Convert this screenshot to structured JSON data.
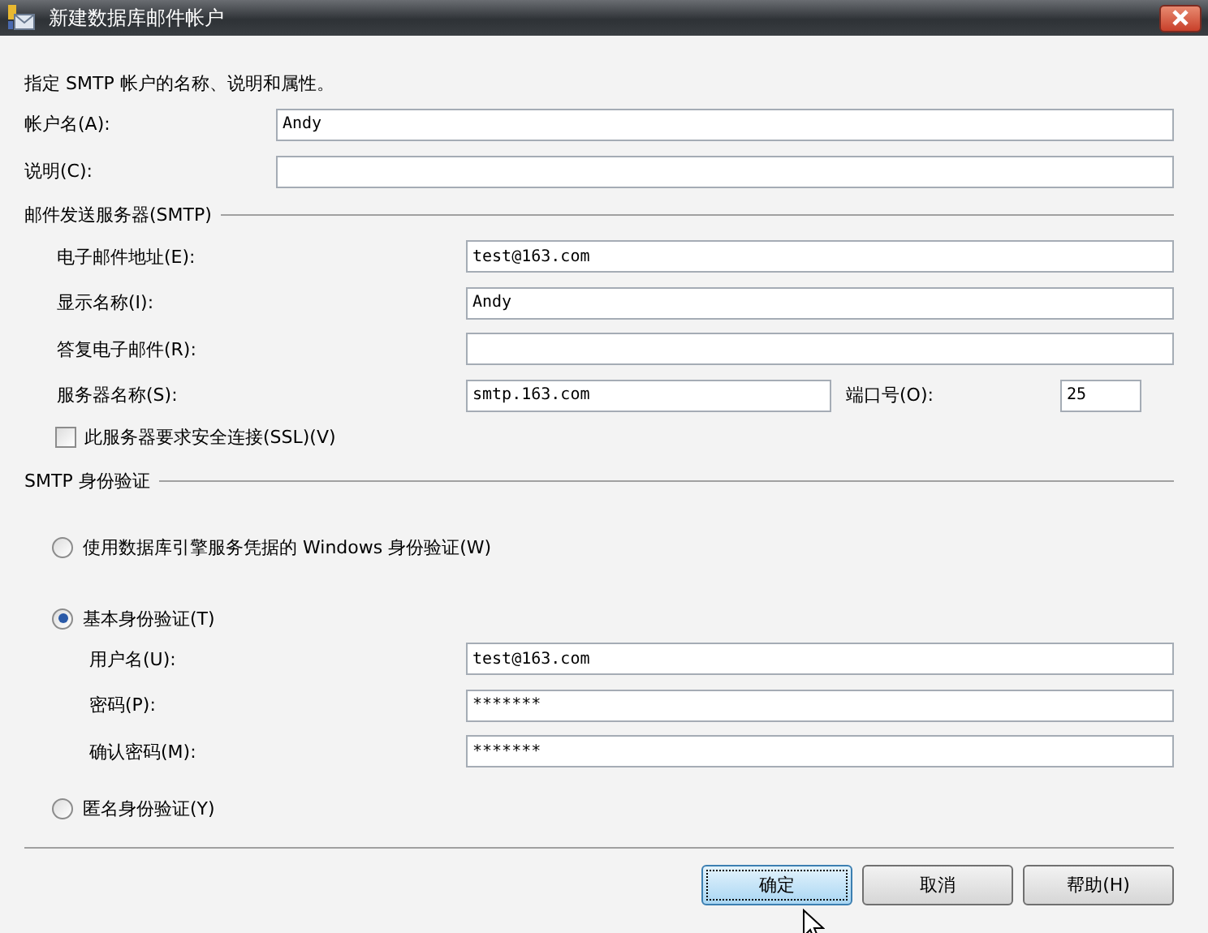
{
  "window": {
    "title": "新建数据库邮件帐户"
  },
  "description": "指定 SMTP 帐户的名称、说明和属性。",
  "account_fields": [
    {
      "label": "帐户名(A):",
      "value": "Andy"
    },
    {
      "label": "说明(C):"
    }
  ],
  "smtp_section": {
    "title": "邮件发送服务器(SMTP)",
    "fields": [
      {
        "label": "电子邮件地址(E):",
        "value": "test@163.com"
      },
      {
        "label": "显示名称(I):",
        "value": "Andy"
      },
      {
        "label": "答复电子邮件(R):"
      }
    ],
    "server": {
      "label": "服务器名称(S):",
      "value": "smtp.163.com"
    },
    "port": {
      "label": "端口号(O):",
      "value": "25"
    },
    "ssl": {
      "label": "此服务器要求安全连接(SSL)(V)",
      "checked": false
    }
  },
  "auth_section": {
    "title": "SMTP 身份验证",
    "options": [
      {
        "label": "使用数据库引擎服务凭据的 Windows 身份验证(W)",
        "selected": false
      },
      {
        "label": "基本身份验证(T)",
        "selected": true,
        "fields": [
          {
            "label": "用户名(U):",
            "value": "test@163.com"
          },
          {
            "label": "密码(P):",
            "value": "*******"
          },
          {
            "label": "确认密码(M):",
            "value": "*******"
          }
        ]
      },
      {
        "label": "匿名身份验证(Y)",
        "selected": false
      }
    ]
  },
  "buttons": [
    {
      "label": "确定",
      "focused": true
    },
    {
      "label": "取消",
      "focused": false
    },
    {
      "label": "帮助(H)",
      "focused": false
    }
  ]
}
